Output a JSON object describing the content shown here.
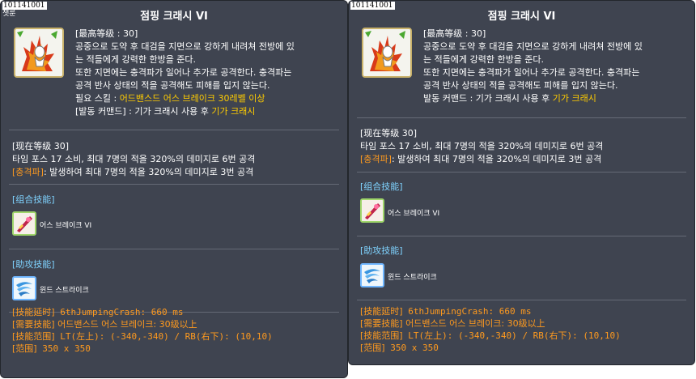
{
  "tooltips": [
    {
      "id": "101141001",
      "subtitle": "챗룬",
      "title": "점핑 크래시 VI",
      "desc": {
        "line1": "[最高等级 : 30]",
        "line2": "공중으로 도약 후 대검을 지면으로 강하게 내려쳐 전방에 있",
        "line3": "는 적들에게 강력한 한방을 준다.",
        "line4": "또한 지면에는 충격파가 일어나 추가로 공격한다. 충격파는",
        "line5": "공격 반사 상태의 적을 공격해도 피해를 입지 않는다.",
        "req_label": "필요 스킬 : ",
        "req_value": "어드밴스드 어스 브레이크 30레벨 이상",
        "cmd_label": "[발동 커맨드] : 기가 크래시 사용 후 ",
        "cmd_value": "기가 크래시"
      },
      "level": {
        "header": "[现在等级 30]",
        "line1": "타임 포스 17 소비, 최대 7명의 적을 320%의 데미지로 6번 공격",
        "shock_label": "[충격파]",
        "shock_text": ": 발생하여 최대 7명의 적을 320%의 데미지로 3번 공격"
      },
      "combo": {
        "header": "[组合技能]",
        "skill": "어스 브레이크 VI"
      },
      "assist": {
        "header": "[助攻技能]",
        "skill": "윈드 스트라이크"
      },
      "footer": {
        "line1_label": "[技能延时]",
        "line1_value": " 6thJumpingCrash: 660 ms",
        "line2_label": "[需要技能]",
        "line2_value": " 어드밴스드 어스 브레이크: 30级以上",
        "line3_label": "[技能范围]",
        "line3_value": " LT(左上): (-340,-340) / RB(右下): (10,10)",
        "line4_label": "[范围]",
        "line4_value": " 350 x 350"
      }
    },
    {
      "id": "101141001",
      "title": "점핑 크래시 VI",
      "desc": {
        "line1": "[最高等级 : 30]",
        "line2": "공중으로 도약 후 대검을 지면으로 강하게 내려쳐 전방에 있",
        "line3": "는 적들에게 강력한 한방을 준다.",
        "line4": "또한 지면에는 충격파가 일어나 추가로 공격한다. 충격파는",
        "line5": "공격 반사 상태의 적을 공격해도 피해를 입지 않는다.",
        "cmd_label": "발동 커맨드 : 기가 크래시 사용 후 ",
        "cmd_value": "기가 크래시"
      },
      "level": {
        "header": "[现在等级 30]",
        "line1": "타임 포스 17 소비, 최대 7명의 적을 320%의 데미지로 6번 공격",
        "shock_label": "[충격파]",
        "shock_text": ": 발생하여 최대 7명의 적을 320%의 데미지로 3번 공격"
      },
      "combo": {
        "header": "[组合技能]",
        "skill": "어스 브레이크 VI"
      },
      "assist": {
        "header": "[助攻技能]",
        "skill": "윈드 스트라이크"
      },
      "footer": {
        "line1_label": "[技能延时]",
        "line1_value": " 6thJumpingCrash: 660 ms",
        "line2_label": "[需要技能]",
        "line2_value": " 어드밴스드 어스 브레이크: 30级以上",
        "line3_label": "[技能范围]",
        "line3_value": " LT(左上): (-340,-340) / RB(右下): (10,10)",
        "line4_label": "[范围]",
        "line4_value": " 350 x 350"
      }
    }
  ],
  "colors": {
    "background": "#3f4450",
    "highlight": "#ffcc00",
    "section_header": "#7fd3ff",
    "footer": "#ff9a1e"
  },
  "icons": {
    "skill": "jumping-crash-skill-icon",
    "combo": "earth-break-skill-icon",
    "assist": "wind-strike-skill-icon"
  }
}
